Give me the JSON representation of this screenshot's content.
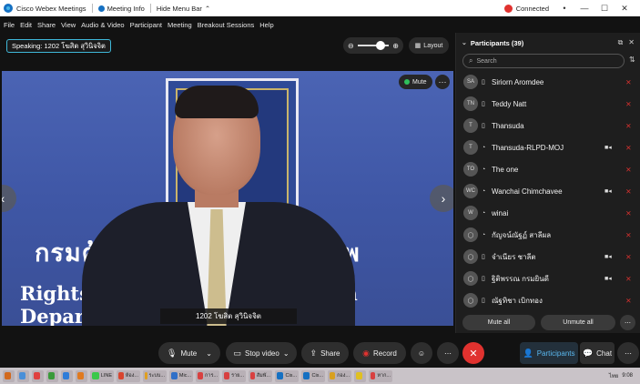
{
  "titlebar": {
    "app_name": "Cisco Webex Meetings",
    "meeting_info": "Meeting Info",
    "hide_menu": "Hide Menu Bar",
    "hide_menu_arrow": "⌃",
    "status": "Connected",
    "status_color": "#e0322f",
    "dropdown": "•",
    "minimize": "—",
    "maximize": "☐",
    "close": "✕"
  },
  "menu": {
    "items": [
      "File",
      "Edit",
      "Share",
      "View",
      "Audio & Video",
      "Participant",
      "Meeting",
      "Breakout Sessions",
      "Help"
    ]
  },
  "stage": {
    "speaking": "Speaking: 1202 โฆสิต สุวินิจจิต",
    "zoom_out_icon": "⊖",
    "zoom_in_icon": "⊕",
    "zoom_level": 0.6,
    "layout_label": "Layout",
    "layout_icon": "▦"
  },
  "video": {
    "banner_th": "กรมคุ้มครองสิทธิและเสรีภาพ",
    "banner_en": "Rights and Liberties Protection Department",
    "mute_label": "Mute",
    "more_icon": "⋯",
    "prev_icon": "‹",
    "next_icon": "›",
    "name_tag": "1202 โฆสิต สุวินิจจิต"
  },
  "controls": {
    "mute": "Mute",
    "mute_icon": "🎙",
    "mute_caret": "⌄",
    "stop_video": "Stop video",
    "video_icon": "▭",
    "video_caret": "⌄",
    "share": "Share",
    "share_icon": "⇪",
    "record": "Record",
    "record_icon": "◉",
    "reactions_icon": "☺",
    "more_icon": "⋯",
    "end_icon": "✕",
    "participants": "Participants",
    "participants_icon": "👤",
    "chat": "Chat",
    "chat_icon": "💬",
    "panel_more_icon": "⋯"
  },
  "panel": {
    "title": "Participants (39)",
    "chevron": "⌄",
    "popout_icon": "⧉",
    "close_icon": "✕",
    "search_placeholder": "Search",
    "search_icon": "⌕",
    "sort_icon": "⇅",
    "participants": [
      {
        "initials": "SA",
        "type": "▯",
        "name": "Siriorn Aromdee",
        "cam": "",
        "mic": "⨯"
      },
      {
        "initials": "TN",
        "type": "▯",
        "name": "Teddy Natt",
        "cam": "",
        "mic": "⨯"
      },
      {
        "initials": "T",
        "type": "▯",
        "name": "Thansuda",
        "cam": "",
        "mic": "⨯"
      },
      {
        "initials": "T",
        "type": "◔",
        "name": "Thansuda-RLPD-MOJ",
        "cam": "■◂",
        "mic": "⨯"
      },
      {
        "initials": "TO",
        "type": "◔",
        "name": "The one",
        "cam": "",
        "mic": "⨯"
      },
      {
        "initials": "WC",
        "type": "◔",
        "name": "Wanchai Chimchavee",
        "cam": "■◂",
        "mic": "⨯"
      },
      {
        "initials": "W",
        "type": "◔",
        "name": "winai",
        "cam": "",
        "mic": "⨯"
      },
      {
        "initials": "◯",
        "type": "◔",
        "name": "กัญจน์ณัฐฏ์ สาลีผล",
        "cam": "",
        "mic": "⨯"
      },
      {
        "initials": "◯",
        "type": "▯",
        "name": "จำเนียร ชาลีต",
        "cam": "■◂",
        "mic": "⨯"
      },
      {
        "initials": "◯",
        "type": "▯",
        "name": "ฐิติพรรณ กรมยินดี",
        "cam": "■◂",
        "mic": "⨯"
      },
      {
        "initials": "◯",
        "type": "▯",
        "name": "ณัฐทิชา เบิกทอง",
        "cam": "",
        "mic": "⨯"
      }
    ],
    "mute_all": "Mute all",
    "unmute_all": "Unmute all",
    "more_icon": "⋯"
  },
  "taskbar": {
    "items": [
      {
        "label": "",
        "color": "#d2691e"
      },
      {
        "label": "",
        "color": "#4a8fd8"
      },
      {
        "label": "",
        "color": "#e04040"
      },
      {
        "label": "",
        "color": "#3a9a3a"
      },
      {
        "label": "",
        "color": "#2f7cd8"
      },
      {
        "label": "",
        "color": "#e07a20"
      },
      {
        "label": "LINE",
        "color": "#3ac84a"
      },
      {
        "label": "ห้อง...",
        "color": "#d8452f"
      },
      {
        "label": "ระบบ...",
        "color": "#e0a020"
      },
      {
        "label": "Mic...",
        "color": "#2f6fc8"
      },
      {
        "label": "การ...",
        "color": "#d84040"
      },
      {
        "label": "ราย...",
        "color": "#d84040"
      },
      {
        "label": "สัมพั...",
        "color": "#d84040"
      },
      {
        "label": "Cis...",
        "color": "#1570c2"
      },
      {
        "label": "Cis...",
        "color": "#1570c2"
      },
      {
        "label": "กอง...",
        "color": "#d8a020"
      },
      {
        "label": "",
        "color": "#e0c020"
      },
      {
        "label": "หาก...",
        "color": "#d84040"
      }
    ],
    "tray": "ไทย",
    "time": "9:08"
  }
}
